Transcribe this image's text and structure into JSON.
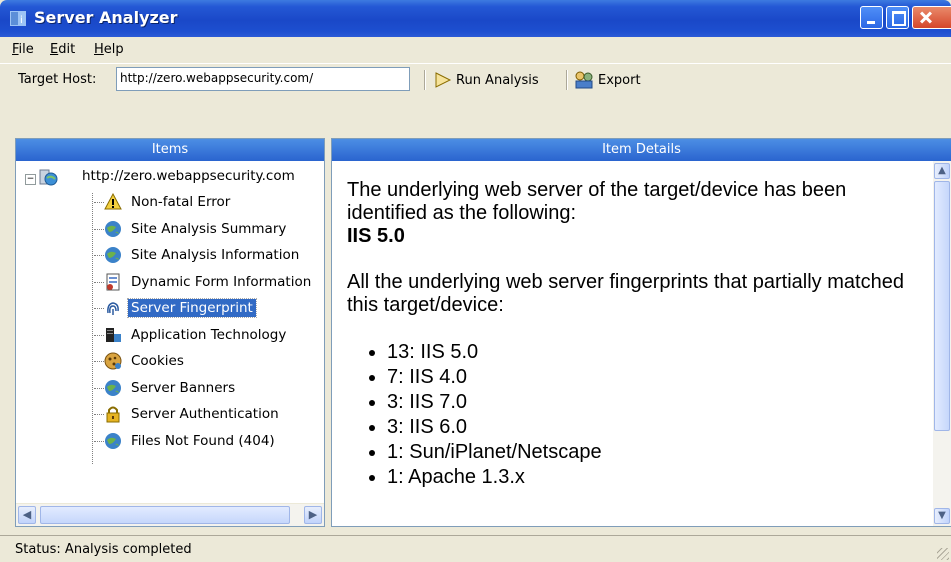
{
  "window": {
    "title": "Server Analyzer"
  },
  "menu": {
    "items": [
      "File",
      "Edit",
      "Help"
    ]
  },
  "toolbar": {
    "host_label": "Target Host:",
    "host_value": "http://zero.webappsecurity.com/",
    "run_label": "Run Analysis",
    "export_label": "Export"
  },
  "items_pane": {
    "header": "Items",
    "root_label": "http://zero.webappsecurity.com",
    "children": [
      {
        "label": "Non-fatal Error",
        "icon": "warning-icon"
      },
      {
        "label": "Site Analysis Summary",
        "icon": "globe-icon"
      },
      {
        "label": "Site Analysis Information",
        "icon": "globe-icon"
      },
      {
        "label": "Dynamic Form Information",
        "icon": "form-icon"
      },
      {
        "label": "Server Fingerprint",
        "icon": "fingerprint-icon",
        "selected": true
      },
      {
        "label": "Application Technology",
        "icon": "server-icon"
      },
      {
        "label": "Cookies",
        "icon": "cookie-icon"
      },
      {
        "label": "Server Banners",
        "icon": "globe-icon"
      },
      {
        "label": "Server Authentication",
        "icon": "lock-icon"
      },
      {
        "label": "Files Not Found (404)",
        "icon": "globe-icon"
      }
    ]
  },
  "details_pane": {
    "header": "Item Details",
    "intro": "The underlying web server of the target/device has been identified as the following:",
    "server": "IIS 5.0",
    "partial_intro": "All the underlying web server fingerprints that partially matched this target/device:",
    "matches": [
      "13: IIS 5.0",
      "7: IIS 4.0",
      "3: IIS 7.0",
      "3: IIS 6.0",
      "1: Sun/iPlanet/Netscape",
      "1: Apache 1.3.x"
    ]
  },
  "status": {
    "text": "Status:  Analysis completed"
  },
  "colors": {
    "titlebar": "#2458d5",
    "selection": "#316ac5",
    "header": "#3a78d8"
  }
}
